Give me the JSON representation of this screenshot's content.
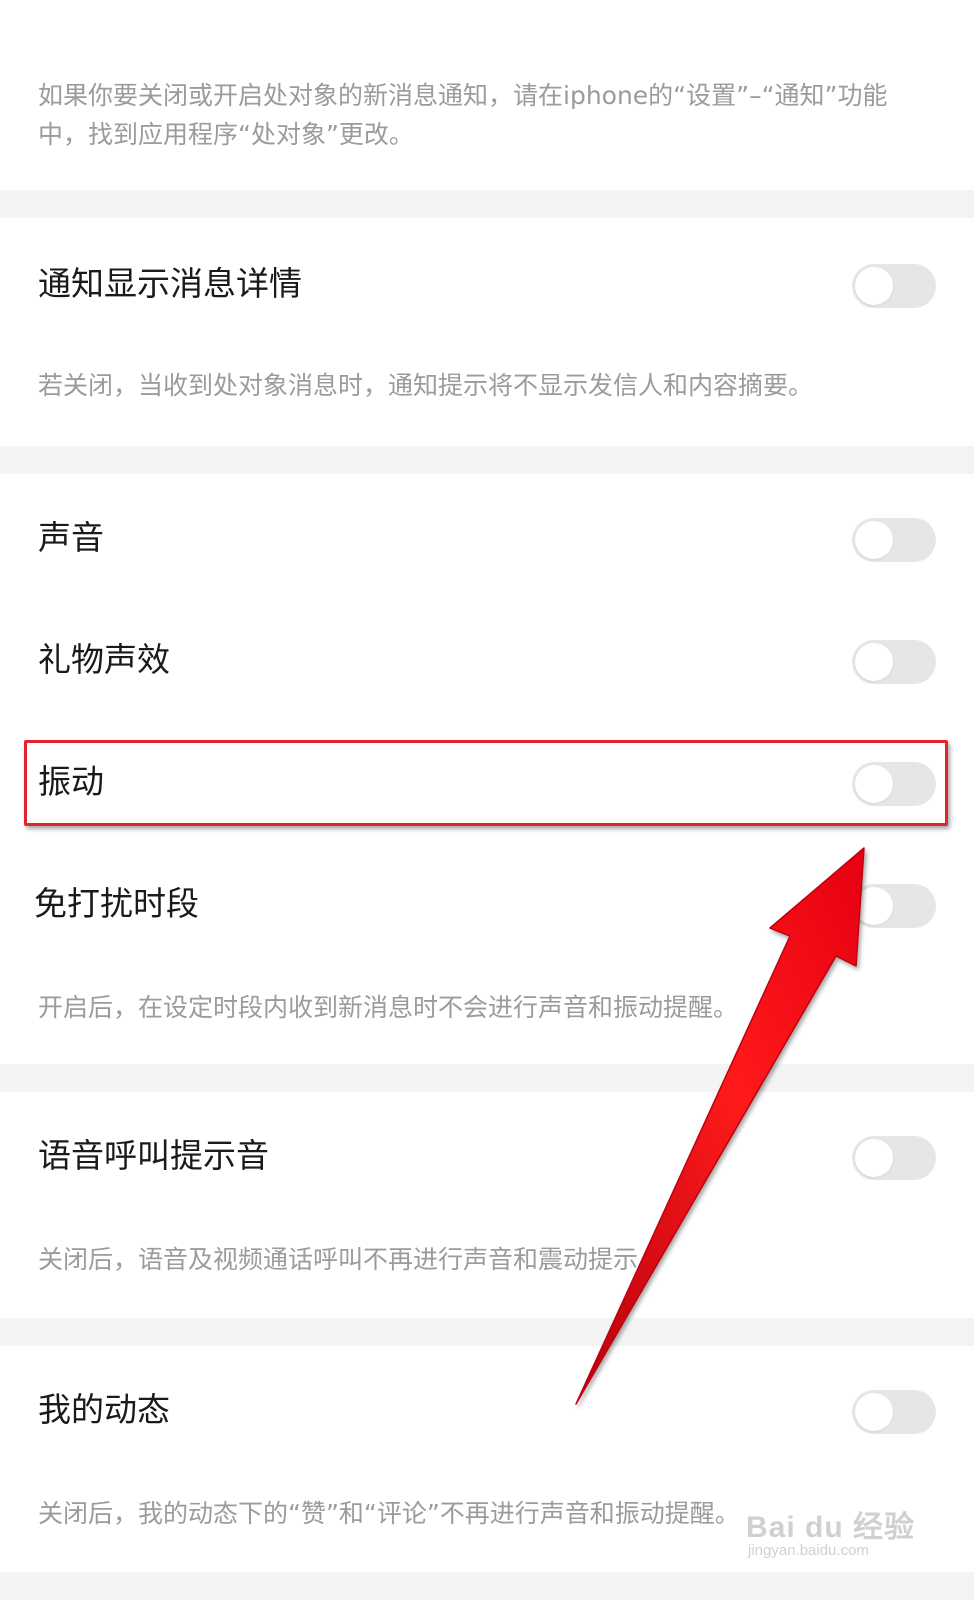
{
  "intro": {
    "text": "如果你要关闭或开启处对象的新消息通知，请在iphone的“设置”–“通知”功能中，找到应用程序“处对象”更改。"
  },
  "settings": {
    "detail": {
      "label": "通知显示消息详情",
      "enabled": false,
      "desc": "若关闭，当收到处对象消息时，通知提示将不显示发信人和内容摘要。"
    },
    "sound": {
      "label": "声音",
      "enabled": false
    },
    "gift_sound": {
      "label": "礼物声效",
      "enabled": false
    },
    "vibrate": {
      "label": "振动",
      "enabled": false
    },
    "dnd": {
      "label": "免打扰时段",
      "enabled": false,
      "desc": "开启后，在设定时段内收到新消息时不会进行声音和振动提醒。"
    },
    "voice_call": {
      "label": "语音呼叫提示音",
      "enabled": false,
      "desc": "关闭后，语音及视频通话呼叫不再进行声音和震动提示。"
    },
    "moments": {
      "label": "我的动态",
      "enabled": false,
      "desc": "关闭后，我的动态下的“赞”和“评论”不再进行声音和振动提醒。"
    }
  },
  "colors": {
    "highlight": "#e5232d",
    "arrow": "#e60012",
    "toggle_off": "#e6e6e6"
  },
  "watermark": {
    "brand": "Bai du 经验",
    "url": "jingyan.baidu.com"
  }
}
